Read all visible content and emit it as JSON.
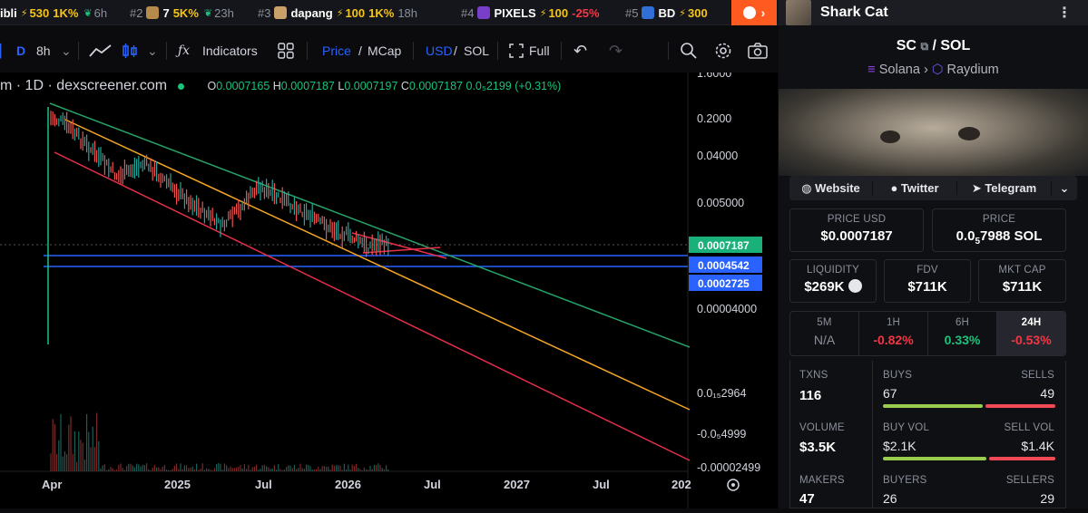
{
  "ticker": [
    {
      "name": "ibli",
      "boost": "530",
      "pct": "1K%",
      "age": "6h"
    },
    {
      "rank": "#2",
      "name": "7",
      "pct": "5K%",
      "age": "23h"
    },
    {
      "rank": "#3",
      "name": "dapang",
      "boost": "100",
      "pct": "1K%",
      "age": "18h"
    },
    {
      "rank": "#4",
      "name": "PIXELS",
      "boost": "100",
      "pct": "-25%"
    },
    {
      "rank": "#5",
      "name": "BD",
      "boost": "300"
    }
  ],
  "header": {
    "token_name": "Shark Cat"
  },
  "toolbar": {
    "interval_d": "D",
    "interval_8h": "8h",
    "indicators": "Indicators",
    "price": "Price",
    "mcap": "MCap",
    "usd": "USD",
    "sol": "SOL",
    "full": "Full"
  },
  "chart": {
    "legend": "m · 1D · dexscreener.com",
    "ohlc": {
      "o": "0.0007165",
      "h": "0.0007187",
      "l": "0.0007197",
      "c": "0.0007187",
      "chg": "0.0₅2199 (+0.31%)"
    },
    "price_labels": [
      "1.6000",
      "0.2000",
      "0.04000",
      "0.005000",
      "0.0007187",
      "0.0004542",
      "0.0002725",
      "0.00004000",
      "0.0₁₅2964",
      "-0.0₅4999",
      "-0.00002499"
    ],
    "time_labels": [
      "Apr",
      "2025",
      "Jul",
      "2026",
      "Jul",
      "2027",
      "Jul",
      "202"
    ]
  },
  "panel": {
    "pair_base": "SC",
    "pair_quote": "SOL",
    "chain": "Solana",
    "dex": "Raydium",
    "links": {
      "website": "Website",
      "twitter": "Twitter",
      "telegram": "Telegram"
    },
    "price_usd_label": "PRICE USD",
    "price_usd": "$0.0007187",
    "price_sol_label": "PRICE",
    "price_sol_a": "0.0",
    "price_sol_sub": "5",
    "price_sol_b": "7988 SOL",
    "liquidity_label": "LIQUIDITY",
    "liquidity": "$269K",
    "fdv_label": "FDV",
    "fdv": "$711K",
    "mcap_label": "MKT CAP",
    "mcap": "$711K",
    "tf": [
      {
        "label": "5M",
        "value": "N/A"
      },
      {
        "label": "1H",
        "value": "-0.82%"
      },
      {
        "label": "6H",
        "value": "0.33%"
      },
      {
        "label": "24H",
        "value": "-0.53%"
      }
    ],
    "txns_label": "TXNS",
    "txns": "116",
    "buys_label": "BUYS",
    "buys": "67",
    "buys_ratio": 0.578,
    "sells_label": "SELLS",
    "sells": "49",
    "volume_label": "VOLUME",
    "volume": "$3.5K",
    "buyvol_label": "BUY VOL",
    "buyvol": "$2.1K",
    "buyvol_ratio": 0.6,
    "sellvol_label": "SELL VOL",
    "sellvol": "$1.4K",
    "makers_label": "MAKERS",
    "makers": "47",
    "buyers_label": "BUYERS",
    "buyers": "26",
    "sellers_label": "SELLERS",
    "sellers": "29"
  }
}
